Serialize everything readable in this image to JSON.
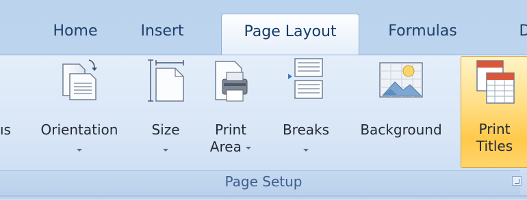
{
  "tabs": [
    {
      "label": "Home"
    },
    {
      "label": "Insert"
    },
    {
      "label": "Page Layout",
      "active": true
    },
    {
      "label": "Formulas"
    },
    {
      "label": "D"
    }
  ],
  "group": {
    "label": "Page Setup",
    "partial_left_label": "ıs",
    "buttons": [
      {
        "label": "Orientation",
        "icon": "orientation-icon",
        "dropdown": true
      },
      {
        "label": "Size",
        "icon": "page-size-icon",
        "dropdown": true
      },
      {
        "label_line1": "Print",
        "label_line2": "Area",
        "icon": "print-area-icon",
        "dropdown": true
      },
      {
        "label": "Breaks",
        "icon": "page-breaks-icon",
        "dropdown": true
      },
      {
        "label": "Background",
        "icon": "background-icon",
        "dropdown": false
      },
      {
        "label_line1": "Print",
        "label_line2": "Titles",
        "icon": "print-titles-icon",
        "dropdown": false,
        "highlighted": true
      }
    ]
  },
  "colors": {
    "tab_text": "#1f3f6a",
    "ribbon_bg": "#dce8f7",
    "highlight": "#ffd56c",
    "group_label": "#3d5f8c"
  }
}
